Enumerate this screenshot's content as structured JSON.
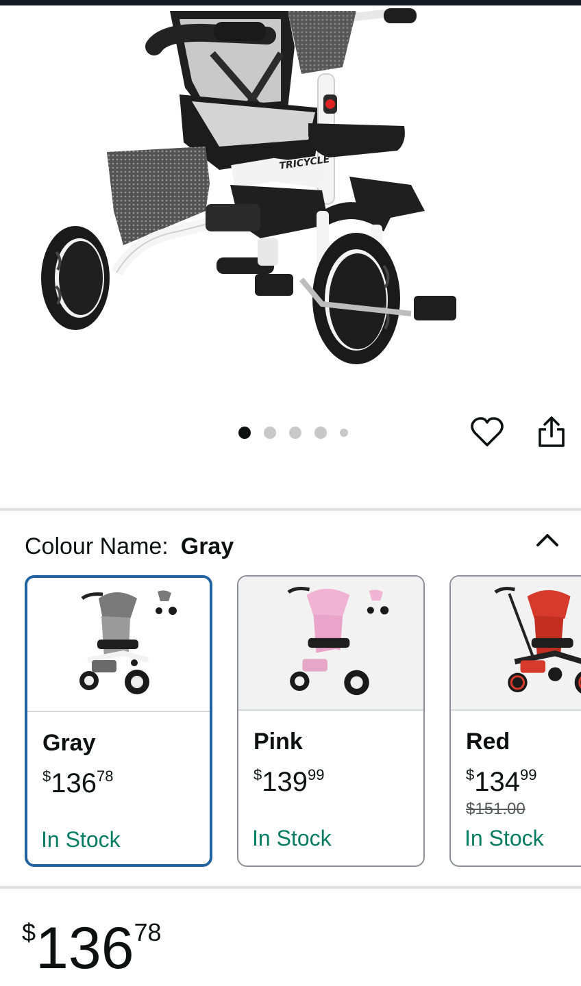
{
  "gallery": {
    "image_count": 5,
    "active_index": 0,
    "frame_label": "TRICYCLE",
    "wishlist_icon": "heart-icon",
    "share_icon": "share-icon"
  },
  "variation": {
    "label": "Colour Name:",
    "value": "Gray",
    "collapse_icon": "chevron-up-icon",
    "options": [
      {
        "name": "Gray",
        "price_symbol": "$",
        "price_whole": "136",
        "price_fraction": "78",
        "list_price": "",
        "stock": "In Stock",
        "selected": true,
        "color": "#7a7a7a"
      },
      {
        "name": "Pink",
        "price_symbol": "$",
        "price_whole": "139",
        "price_fraction": "99",
        "list_price": "",
        "stock": "In Stock",
        "selected": false,
        "color": "#f0b3d3"
      },
      {
        "name": "Red",
        "price_symbol": "$",
        "price_whole": "134",
        "price_fraction": "99",
        "list_price": "$151.00",
        "stock": "In Stock",
        "selected": false,
        "color": "#d63a2c"
      }
    ]
  },
  "price": {
    "symbol": "$",
    "whole": "136",
    "fraction": "78"
  },
  "colors": {
    "accent": "#2162a1",
    "stock": "#067d62",
    "text": "#0f1111"
  }
}
